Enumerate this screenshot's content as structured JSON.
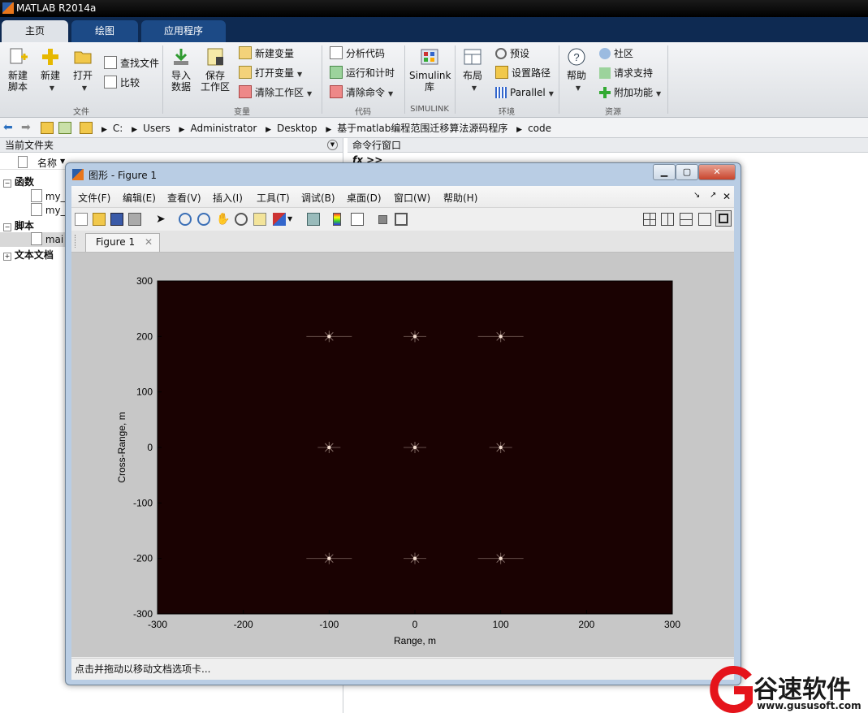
{
  "app": {
    "title": "MATLAB R2014a"
  },
  "ribbon_tabs": [
    "主页",
    "绘图",
    "应用程序"
  ],
  "ribbon": {
    "file": {
      "group": "文件",
      "new_script": [
        "新建",
        "脚本"
      ],
      "new": "新建",
      "open": "打开",
      "find_files": "查找文件",
      "compare": "比较"
    },
    "variable": {
      "group": "变量",
      "import": [
        "导入",
        "数据"
      ],
      "save_ws": [
        "保存",
        "工作区"
      ],
      "new_var": "新建变量",
      "open_var": "打开变量",
      "clear_ws": "清除工作区"
    },
    "code": {
      "group": "代码",
      "analyze": "分析代码",
      "run_time": "运行和计时",
      "clear_cmd": "清除命令"
    },
    "simulink": {
      "group": "SIMULINK",
      "lib": [
        "Simulink",
        "库"
      ]
    },
    "env": {
      "group": "环境",
      "layout": "布局",
      "prefs": "预设",
      "set_path": "设置路径",
      "parallel": "Parallel"
    },
    "resources": {
      "group": "资源",
      "help": "帮助",
      "community": "社区",
      "request": "请求支持",
      "addons": "附加功能"
    }
  },
  "address": {
    "crumbs": [
      "C:",
      "Users",
      "Administrator",
      "Desktop",
      "基于matlab编程范围迁移算法源码程序",
      "code"
    ]
  },
  "current_folder": {
    "title": "当前文件夹",
    "column": "名称",
    "groups": [
      {
        "label": "函数",
        "items": [
          "my_",
          "my_"
        ]
      },
      {
        "label": "脚本",
        "items": [
          "mai"
        ]
      },
      {
        "label": "文本文档",
        "items": []
      }
    ]
  },
  "command_window": {
    "title": "命令行窗口",
    "prompt": "fx >>"
  },
  "figure": {
    "title": "图形 - Figure 1",
    "menus": [
      "文件(F)",
      "编辑(E)",
      "查看(V)",
      "插入(I)",
      "工具(T)",
      "调试(B)",
      "桌面(D)",
      "窗口(W)",
      "帮助(H)"
    ],
    "tab": "Figure 1",
    "status": "点击并拖动以移动文档选项卡..."
  },
  "chart_data": {
    "type": "scatter",
    "xlabel": "Range, m",
    "ylabel": "Cross-Range, m",
    "xlim": [
      -300,
      300
    ],
    "ylim": [
      300,
      -300
    ],
    "xticks": [
      -300,
      -200,
      -100,
      0,
      100,
      200,
      300
    ],
    "yticks": [
      -300,
      -200,
      -100,
      0,
      100,
      200,
      300
    ],
    "background": "#1a0202",
    "point_color": "#f2dccf",
    "points": [
      {
        "x": -100,
        "y": -200
      },
      {
        "x": 0,
        "y": -200
      },
      {
        "x": 100,
        "y": -200
      },
      {
        "x": -100,
        "y": 0
      },
      {
        "x": 0,
        "y": 0
      },
      {
        "x": 100,
        "y": 0
      },
      {
        "x": -100,
        "y": 200
      },
      {
        "x": 0,
        "y": 200
      },
      {
        "x": 100,
        "y": 200
      }
    ]
  },
  "watermark": {
    "name": "谷速软件",
    "url": "www.gususoft.com"
  }
}
